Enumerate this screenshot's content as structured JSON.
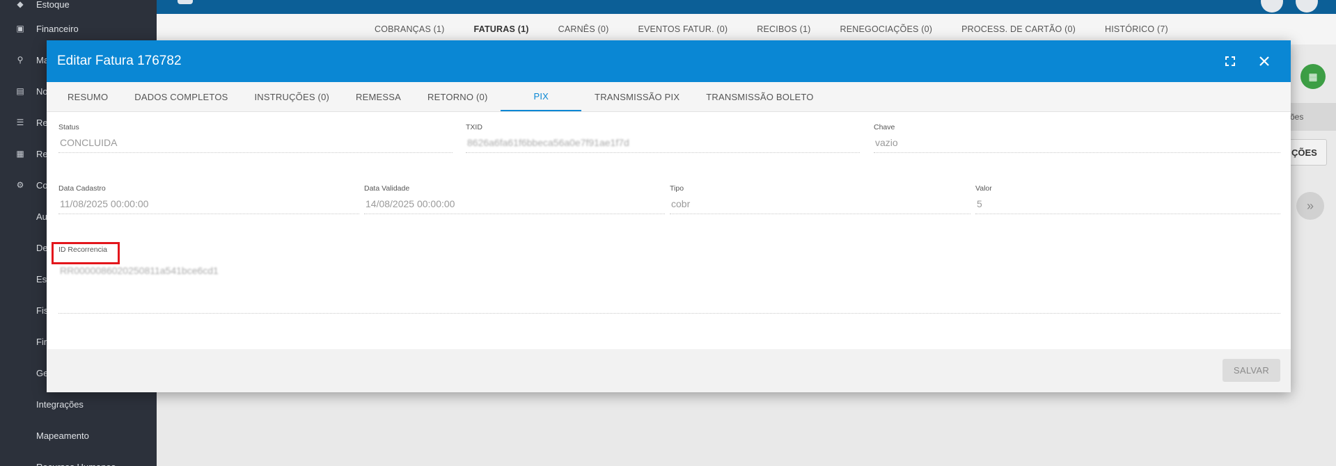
{
  "sidebar": {
    "items": [
      {
        "label": "Estoque",
        "icon": "box-icon"
      },
      {
        "label": "Financeiro",
        "icon": "money-icon"
      },
      {
        "label": "Ma",
        "icon": "map-pin-icon"
      },
      {
        "label": "No",
        "icon": "document-icon"
      },
      {
        "label": "Re",
        "icon": "server-icon"
      },
      {
        "label": "Re",
        "icon": "file-icon"
      },
      {
        "label": "Co",
        "icon": "gear-icon"
      }
    ],
    "subitems": [
      "Au",
      "De",
      "Es",
      "Fis",
      "Fin",
      "Ge",
      "Integrações",
      "Mapeamento",
      "Recursos Humanos"
    ]
  },
  "background_tabs": [
    "COBRANÇAS (1)",
    "FATURAS (1)",
    "CARNÊS (0)",
    "EVENTOS FATUR. (0)",
    "RECIBOS (1)",
    "RENEGOCIAÇÕES (0)",
    "PROCESS. DE CARTÃO (0)",
    "HISTÓRICO (7)"
  ],
  "background_right": {
    "panel_text": "ões",
    "button_text": "ÇÕES"
  },
  "modal": {
    "title": "Editar Fatura 176782",
    "tabs": [
      "RESUMO",
      "DADOS COMPLETOS",
      "INSTRUÇÕES (0)",
      "REMESSA",
      "RETORNO (0)",
      "PIX",
      "TRANSMISSÃO PIX",
      "TRANSMISSÃO BOLETO"
    ],
    "active_tab": "PIX",
    "fields": {
      "status": {
        "label": "Status",
        "value": "CONCLUIDA"
      },
      "txid": {
        "label": "TXID",
        "value": "8626a6fa61f6bbeca56a0e7f91ae1f7d"
      },
      "chave": {
        "label": "Chave",
        "value": "vazio"
      },
      "data_cadastro": {
        "label": "Data Cadastro",
        "value": "11/08/2025 00:00:00"
      },
      "data_validade": {
        "label": "Data Validade",
        "value": "14/08/2025 00:00:00"
      },
      "tipo": {
        "label": "Tipo",
        "value": "cobr"
      },
      "valor": {
        "label": "Valor",
        "value": "5"
      },
      "id_recorrencia": {
        "label": "ID Recorrencia",
        "value": "RR0000086020250811a541bce6cd1"
      }
    },
    "save_label": "SALVAR"
  },
  "colors": {
    "header": "#0a87d4",
    "sidebar": "#2c313b",
    "highlight": "#e3161c",
    "accent_green": "#3d9e45"
  }
}
